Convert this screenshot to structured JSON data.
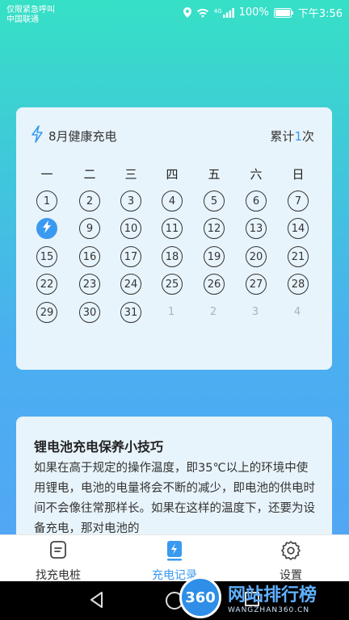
{
  "status": {
    "line1": "仅限紧急呼叫",
    "line2": "中国联通",
    "signal_label": "4G",
    "battery": "100%",
    "time": "下午3:56"
  },
  "calendar": {
    "title": "8月健康充电",
    "count_prefix": "累计",
    "count_value": "1",
    "count_suffix": "次",
    "weekdays": [
      "一",
      "二",
      "三",
      "四",
      "五",
      "六",
      "日"
    ],
    "days": [
      {
        "label": "1",
        "type": "normal"
      },
      {
        "label": "2",
        "type": "normal"
      },
      {
        "label": "3",
        "type": "normal"
      },
      {
        "label": "4",
        "type": "normal"
      },
      {
        "label": "5",
        "type": "normal"
      },
      {
        "label": "6",
        "type": "normal"
      },
      {
        "label": "7",
        "type": "normal"
      },
      {
        "label": "",
        "type": "charged"
      },
      {
        "label": "9",
        "type": "normal"
      },
      {
        "label": "10",
        "type": "normal"
      },
      {
        "label": "11",
        "type": "normal"
      },
      {
        "label": "12",
        "type": "normal"
      },
      {
        "label": "13",
        "type": "normal"
      },
      {
        "label": "14",
        "type": "normal"
      },
      {
        "label": "15",
        "type": "normal"
      },
      {
        "label": "16",
        "type": "normal"
      },
      {
        "label": "17",
        "type": "normal"
      },
      {
        "label": "18",
        "type": "normal"
      },
      {
        "label": "19",
        "type": "normal"
      },
      {
        "label": "20",
        "type": "normal"
      },
      {
        "label": "21",
        "type": "normal"
      },
      {
        "label": "22",
        "type": "normal"
      },
      {
        "label": "23",
        "type": "normal"
      },
      {
        "label": "24",
        "type": "normal"
      },
      {
        "label": "25",
        "type": "normal"
      },
      {
        "label": "26",
        "type": "normal"
      },
      {
        "label": "27",
        "type": "normal"
      },
      {
        "label": "28",
        "type": "normal"
      },
      {
        "label": "29",
        "type": "normal"
      },
      {
        "label": "30",
        "type": "normal"
      },
      {
        "label": "31",
        "type": "normal"
      },
      {
        "label": "1",
        "type": "dim"
      },
      {
        "label": "2",
        "type": "dim"
      },
      {
        "label": "3",
        "type": "dim"
      },
      {
        "label": "4",
        "type": "dim"
      }
    ]
  },
  "tips": {
    "title": "锂电池充电保养小技巧",
    "body": "如果在高于规定的操作温度，即35℃以上的环境中使用锂电，电池的电量将会不断的减少，即电池的供电时间不会像往常那样长。如果在这样的温度下，还要为设备充电，那对电池的"
  },
  "tabs": [
    {
      "label": "找充电桩",
      "icon": "charging-pile-icon",
      "active": false
    },
    {
      "label": "充电记录",
      "icon": "charge-record-icon",
      "active": true
    },
    {
      "label": "设置",
      "icon": "gear-icon",
      "active": false
    }
  ],
  "watermark": {
    "logo": "360",
    "title": "网站排行榜",
    "url": "WANGZHAN360.CN"
  },
  "colors": {
    "accent": "#3a9af0",
    "card": "#e8f4fb"
  }
}
